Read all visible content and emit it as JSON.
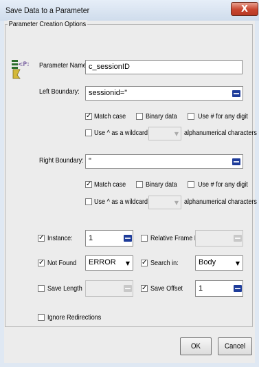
{
  "window": {
    "title": "Save Data to a Parameter",
    "close_glyph": "X"
  },
  "group": {
    "legend": "Parameter Creation Options"
  },
  "parameter_name": {
    "label": "Parameter Name:",
    "value": "c_sessionID"
  },
  "left_boundary": {
    "label": "Left Boundary:",
    "value": "sessionid=\"",
    "match_case": {
      "label": "Match case",
      "checked": true
    },
    "binary_data": {
      "label": "Binary data",
      "checked": false
    },
    "use_hash": {
      "label": "Use # for any digit",
      "checked": false
    },
    "wildcard": {
      "label": "Use ^ as a wildcard for",
      "suffix": "alphanumerical characters",
      "checked": false
    }
  },
  "right_boundary": {
    "label": "Right Boundary:",
    "value": "\"",
    "match_case": {
      "label": "Match case",
      "checked": true
    },
    "binary_data": {
      "label": "Binary data",
      "checked": false
    },
    "use_hash": {
      "label": "Use # for any digit",
      "checked": false
    },
    "wildcard": {
      "label": "Use ^ as a wildcard for",
      "suffix": "alphanumerical characters",
      "checked": false
    }
  },
  "instance": {
    "label": "Instance:",
    "value": "1",
    "checked": true
  },
  "relative_frame": {
    "label": "Relative Frame ID:",
    "value": "",
    "checked": false
  },
  "not_found": {
    "label": "Not Found",
    "value": "ERROR",
    "checked": true
  },
  "search_in": {
    "label": "Search in:",
    "value": "Body",
    "checked": true
  },
  "save_length": {
    "label": "Save Length",
    "value": "",
    "checked": false
  },
  "save_offset": {
    "label": "Save Offset",
    "value": "1",
    "checked": true
  },
  "ignore_redirections": {
    "label": "Ignore Redirections",
    "checked": false
  },
  "buttons": {
    "ok": "OK",
    "cancel": "Cancel"
  },
  "glyphs": {
    "check": "✓",
    "dropdown": "▼"
  },
  "icons": {
    "parameter": "parameter-icon",
    "abc": "abc-dictionary-icon",
    "close": "close-icon"
  }
}
